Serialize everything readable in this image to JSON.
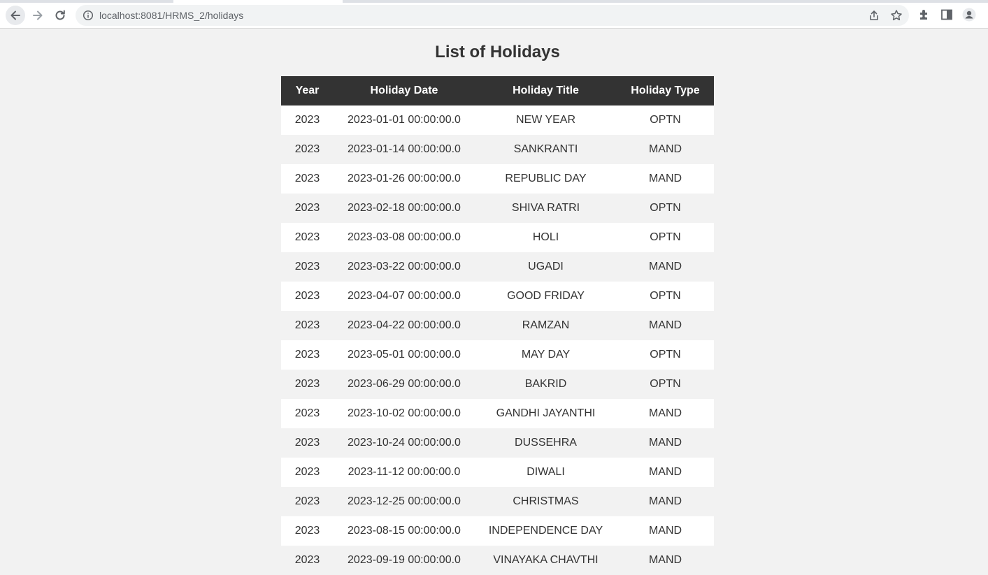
{
  "browser": {
    "url": "localhost:8081/HRMS_2/holidays",
    "icons": [
      "back-icon",
      "forward-icon",
      "reload-icon",
      "info-icon",
      "share-icon",
      "star-icon",
      "extensions-icon",
      "side-panel-icon",
      "profile-icon"
    ]
  },
  "page": {
    "title": "List of Holidays"
  },
  "table": {
    "columns": [
      "Year",
      "Holiday Date",
      "Holiday Title",
      "Holiday Type"
    ],
    "rows": [
      [
        "2023",
        "2023-01-01 00:00:00.0",
        "NEW YEAR",
        "OPTN"
      ],
      [
        "2023",
        "2023-01-14 00:00:00.0",
        "SANKRANTI",
        "MAND"
      ],
      [
        "2023",
        "2023-01-26 00:00:00.0",
        "REPUBLIC DAY",
        "MAND"
      ],
      [
        "2023",
        "2023-02-18 00:00:00.0",
        "SHIVA RATRI",
        "OPTN"
      ],
      [
        "2023",
        "2023-03-08 00:00:00.0",
        "HOLI",
        "OPTN"
      ],
      [
        "2023",
        "2023-03-22 00:00:00.0",
        "UGADI",
        "MAND"
      ],
      [
        "2023",
        "2023-04-07 00:00:00.0",
        "GOOD FRIDAY",
        "OPTN"
      ],
      [
        "2023",
        "2023-04-22 00:00:00.0",
        "RAMZAN",
        "MAND"
      ],
      [
        "2023",
        "2023-05-01 00:00:00.0",
        "MAY DAY",
        "OPTN"
      ],
      [
        "2023",
        "2023-06-29 00:00:00.0",
        "BAKRID",
        "OPTN"
      ],
      [
        "2023",
        "2023-10-02 00:00:00.0",
        "GANDHI JAYANTHI",
        "MAND"
      ],
      [
        "2023",
        "2023-10-24 00:00:00.0",
        "DUSSEHRA",
        "MAND"
      ],
      [
        "2023",
        "2023-11-12 00:00:00.0",
        "DIWALI",
        "MAND"
      ],
      [
        "2023",
        "2023-12-25 00:00:00.0",
        "CHRISTMAS",
        "MAND"
      ],
      [
        "2023",
        "2023-08-15 00:00:00.0",
        "INDEPENDENCE DAY",
        "MAND"
      ],
      [
        "2023",
        "2023-09-19 00:00:00.0",
        "VINAYAKA CHAVTHI",
        "MAND"
      ]
    ]
  },
  "colors": {
    "header_bg": "#333333",
    "header_text": "#ffffff",
    "page_bg": "#f2f2f2",
    "row_alt_bg": "#f2f2f2",
    "row_bg": "#ffffff"
  }
}
